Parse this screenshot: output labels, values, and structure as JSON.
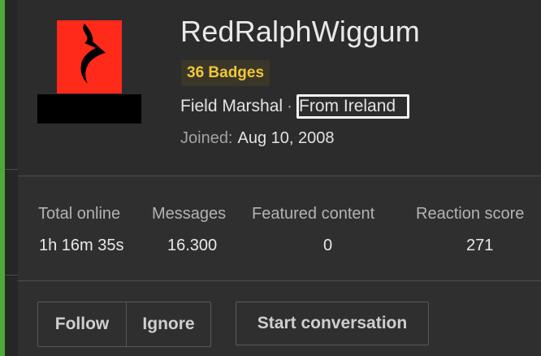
{
  "profile": {
    "username": "RedRalphWiggum",
    "badges": "36 Badges",
    "rank": "Field Marshal",
    "separator": "·",
    "location": "From Ireland",
    "joined_label": "Joined:",
    "joined_date": "Aug 10, 2008"
  },
  "stats": [
    {
      "label": "Total online",
      "value": "1h 16m 35s"
    },
    {
      "label": "Messages",
      "value": "16.300"
    },
    {
      "label": "Featured content",
      "value": "0"
    },
    {
      "label": "Reaction score",
      "value": "271"
    }
  ],
  "actions": {
    "follow": "Follow",
    "ignore": "Ignore",
    "start_conversation": "Start conversation"
  },
  "colors": {
    "accent_green": "#4caa3a",
    "badge_text": "#f0c63a",
    "avatar_red": "#ff2a1a"
  },
  "icons": {
    "avatar_mark": "black-flame-swirl"
  }
}
